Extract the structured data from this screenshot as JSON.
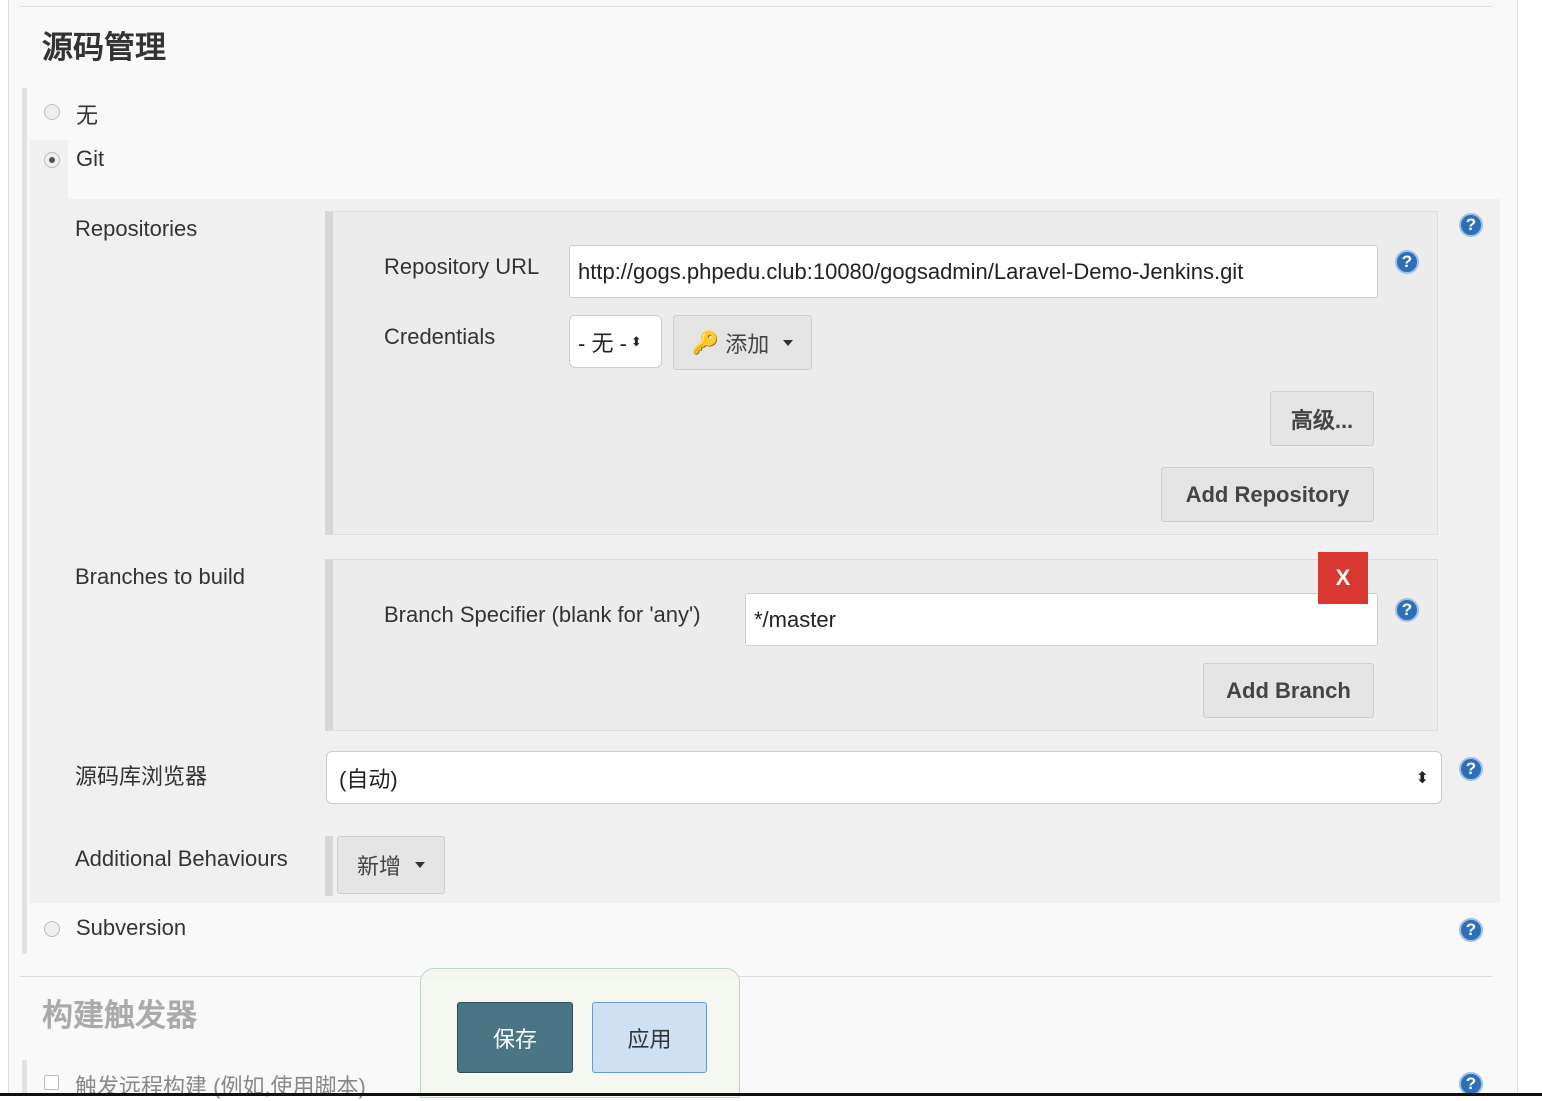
{
  "section_title": "源码管理",
  "scm_options": [
    {
      "label": "无",
      "selected": false
    },
    {
      "label": "Git",
      "selected": true
    },
    {
      "label": "Subversion",
      "selected": false
    }
  ],
  "git": {
    "repositories_label": "Repositories",
    "repo_url_label": "Repository URL",
    "repo_url_value": "http://gogs.phpedu.club:10080/gogsadmin/Laravel-Demo-Jenkins.git",
    "credentials_label": "Credentials",
    "credentials_value": "- 无 -",
    "add_label": "添加",
    "advanced_label": "高级...",
    "add_repository_label": "Add Repository",
    "branches_label": "Branches to build",
    "branch_specifier_label": "Branch Specifier (blank for 'any')",
    "branch_specifier_value": "*/master",
    "delete_label": "X",
    "add_branch_label": "Add Branch",
    "browser_label": "源码库浏览器",
    "browser_value": "(自动)",
    "behaviours_label": "Additional Behaviours",
    "behaviours_add_label": "新增"
  },
  "next_section_title": "构建触发器",
  "trigger_remote_label": "触发远程构建 (例如,使用脚本)",
  "footer": {
    "save_label": "保存",
    "apply_label": "应用"
  },
  "help_glyph": "?",
  "colors": {
    "save": "#4a7585",
    "apply": "#cfe0f2",
    "delete": "#d9372f",
    "help": "#2f6fb5"
  }
}
